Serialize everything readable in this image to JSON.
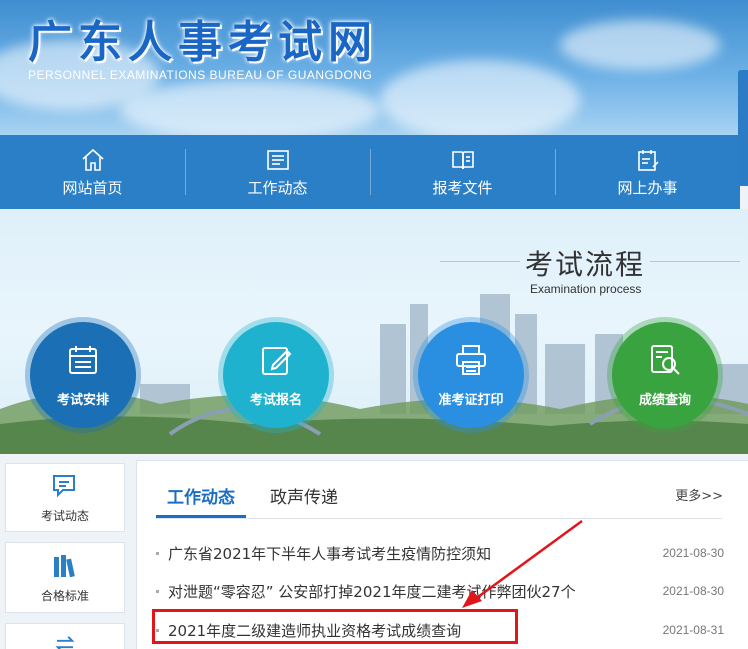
{
  "header": {
    "title": "广东人事考试网",
    "subtitle": "PERSONNEL EXAMINATIONS BUREAU OF GUANGDONG"
  },
  "nav": {
    "items": [
      {
        "label": "网站首页",
        "icon": "home-icon"
      },
      {
        "label": "工作动态",
        "icon": "news-icon"
      },
      {
        "label": "报考文件",
        "icon": "book-icon"
      },
      {
        "label": "网上办事",
        "icon": "clipboard-icon"
      }
    ]
  },
  "process": {
    "title": "考试流程",
    "subtitle": "Examination process",
    "steps": [
      {
        "label": "考试安排",
        "icon": "calendar-icon",
        "color": "#1b6fb5"
      },
      {
        "label": "考试报名",
        "icon": "edit-icon",
        "color": "#1fb3cf"
      },
      {
        "label": "准考证打印",
        "icon": "printer-icon",
        "color": "#2a8fe0"
      },
      {
        "label": "成绩查询",
        "icon": "search-doc-icon",
        "color": "#3aa33f"
      }
    ]
  },
  "sidebar": {
    "items": [
      {
        "label": "考试动态",
        "icon": "chat-icon"
      },
      {
        "label": "合格标准",
        "icon": "books-icon"
      },
      {
        "label": "",
        "icon": "exchange-icon"
      }
    ]
  },
  "panel": {
    "tabs": [
      {
        "label": "工作动态",
        "active": true
      },
      {
        "label": "政声传递",
        "active": false
      }
    ],
    "more": "更多>>",
    "news": [
      {
        "title": "广东省2021年下半年人事考试考生疫情防控须知",
        "date": "2021-08-30"
      },
      {
        "title": "对泄题“零容忍” 公安部打掉2021年度二建考试作弊团伙27个",
        "date": "2021-08-30"
      },
      {
        "title": "2021年度二级建造师执业资格考试成绩查询",
        "date": "2021-08-31"
      }
    ]
  },
  "colors": {
    "brand_blue": "#1a6fc4",
    "nav_blue": "#2b7fc6",
    "highlight_red": "#e0161b"
  }
}
